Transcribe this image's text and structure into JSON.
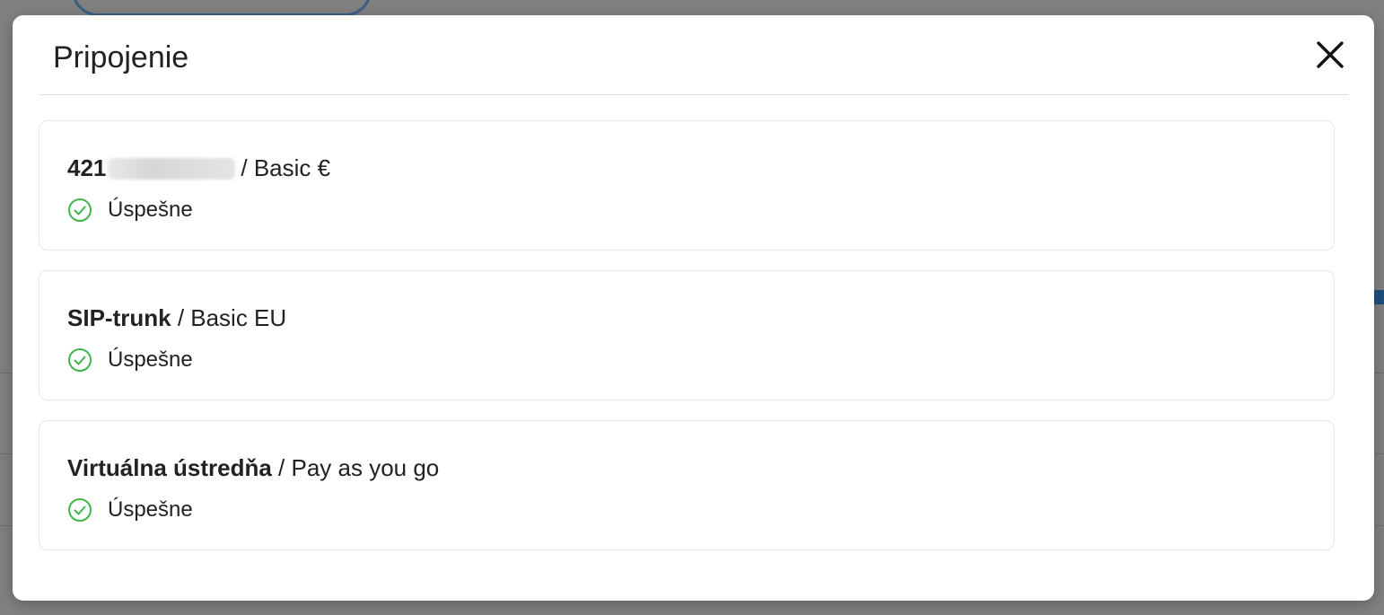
{
  "dialog": {
    "title": "Pripojenie",
    "close_icon": "close-icon"
  },
  "connections": [
    {
      "name": "421",
      "plan": "/ Basic €",
      "status": "Úspešne",
      "status_icon": "check-circle-icon",
      "name_partially_redacted": true
    },
    {
      "name": "SIP-trunk",
      "plan": "/ Basic EU",
      "status": "Úspešne",
      "status_icon": "check-circle-icon"
    },
    {
      "name": "Virtuálna ústredňa",
      "plan": "/ Pay as you go",
      "status": "Úspešne",
      "status_icon": "check-circle-icon"
    }
  ],
  "colors": {
    "success": "#3fb54c",
    "overlay": "#808080",
    "text": "#222222"
  }
}
